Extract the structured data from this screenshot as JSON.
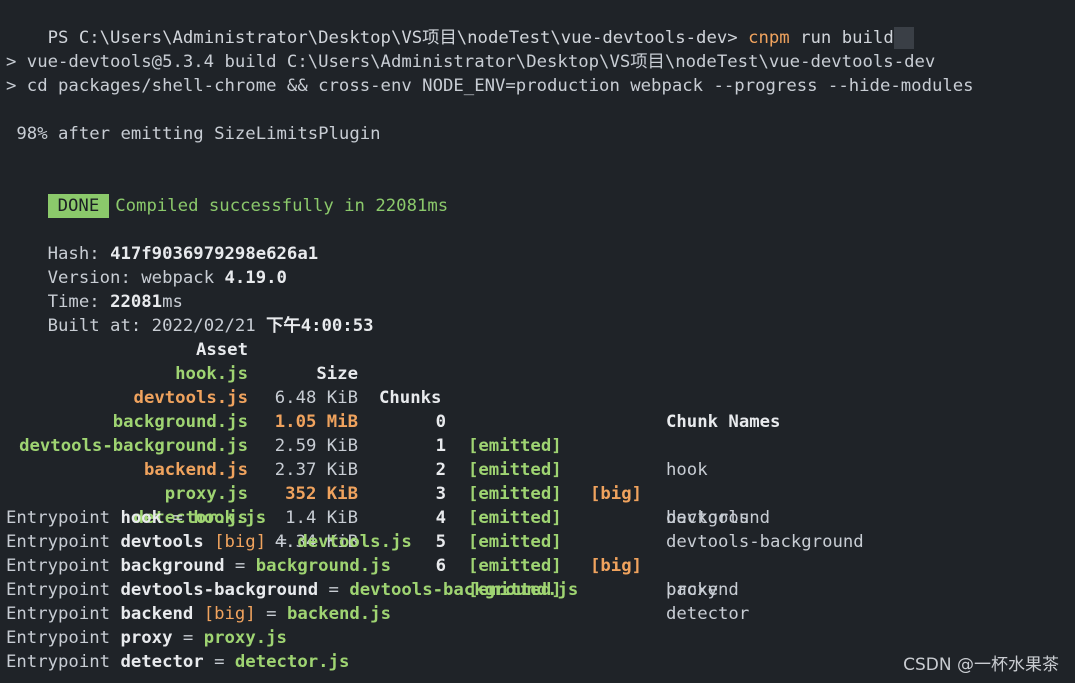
{
  "prompt": {
    "path": "PS C:\\Users\\Administrator\\Desktop\\VS项目\\nodeTest\\vue-devtools-dev> ",
    "command_exe": "cnpm",
    "command_args": " run build"
  },
  "script_lines": [
    "> vue-devtools@5.3.4 build C:\\Users\\Administrator\\Desktop\\VS项目\\nodeTest\\vue-devtools-dev",
    "> cd packages/shell-chrome && cross-env NODE_ENV=production webpack --progress --hide-modules"
  ],
  "progress_line": " 98% after emitting SizeLimitsPlugin",
  "done_badge": "DONE",
  "done_message": "Compiled successfully in 22081ms",
  "stats": {
    "hash_label": "Hash: ",
    "hash_value": "417f9036979298e626a1",
    "version_label": "Version: webpack ",
    "version_value": "4.19.0",
    "time_label": "Time: ",
    "time_value": "22081",
    "time_unit": "ms",
    "built_label": "Built at: 2022/02/21 ",
    "built_value": "下午4:00:53"
  },
  "table": {
    "headers": {
      "asset": "Asset",
      "size": "Size",
      "chunks": "Chunks",
      "chunk_names": "Chunk Names"
    },
    "rows": [
      {
        "asset": "hook.js",
        "size": "6.48 KiB",
        "chunk": "0",
        "emitted": "[emitted]",
        "big": "",
        "name": "hook"
      },
      {
        "asset": "devtools.js",
        "size": "1.05 MiB",
        "chunk": "1",
        "emitted": "[emitted]",
        "big": "[big]",
        "name": "devtools"
      },
      {
        "asset": "background.js",
        "size": "2.59 KiB",
        "chunk": "2",
        "emitted": "[emitted]",
        "big": "",
        "name": "background"
      },
      {
        "asset": "devtools-background.js",
        "size": "2.37 KiB",
        "chunk": "3",
        "emitted": "[emitted]",
        "big": "",
        "name": "devtools-background"
      },
      {
        "asset": "backend.js",
        "size": "352 KiB",
        "chunk": "4",
        "emitted": "[emitted]",
        "big": "[big]",
        "name": "backend"
      },
      {
        "asset": "proxy.js",
        "size": "1.4 KiB",
        "chunk": "5",
        "emitted": "[emitted]",
        "big": "",
        "name": "proxy"
      },
      {
        "asset": "detector.js",
        "size": "4.34 KiB",
        "chunk": "6",
        "emitted": "[emitted]",
        "big": "",
        "name": "detector"
      }
    ]
  },
  "entrypoints": [
    {
      "label": "Entrypoint ",
      "name": "hook",
      "big": "",
      "eq": " = ",
      "file": "hook.js"
    },
    {
      "label": "Entrypoint ",
      "name": "devtools",
      "big": "[big]",
      "eq": " = ",
      "file": "devtools.js"
    },
    {
      "label": "Entrypoint ",
      "name": "background",
      "big": "",
      "eq": " = ",
      "file": "background.js"
    },
    {
      "label": "Entrypoint ",
      "name": "devtools-background",
      "big": "",
      "eq": " = ",
      "file": "devtools-background.js"
    },
    {
      "label": "Entrypoint ",
      "name": "backend",
      "big": "[big]",
      "eq": " = ",
      "file": "backend.js"
    },
    {
      "label": "Entrypoint ",
      "name": "proxy",
      "big": "",
      "eq": " = ",
      "file": "proxy.js"
    },
    {
      "label": "Entrypoint ",
      "name": "detector",
      "big": "",
      "eq": " = ",
      "file": "detector.js"
    }
  ],
  "watermark": "CSDN @一杯水果茶",
  "colors": {
    "background": "#1f2328",
    "text": "#c8cdd4",
    "green": "#9fd472",
    "orange": "#f0a35e",
    "done_bg": "#8bc96b"
  }
}
